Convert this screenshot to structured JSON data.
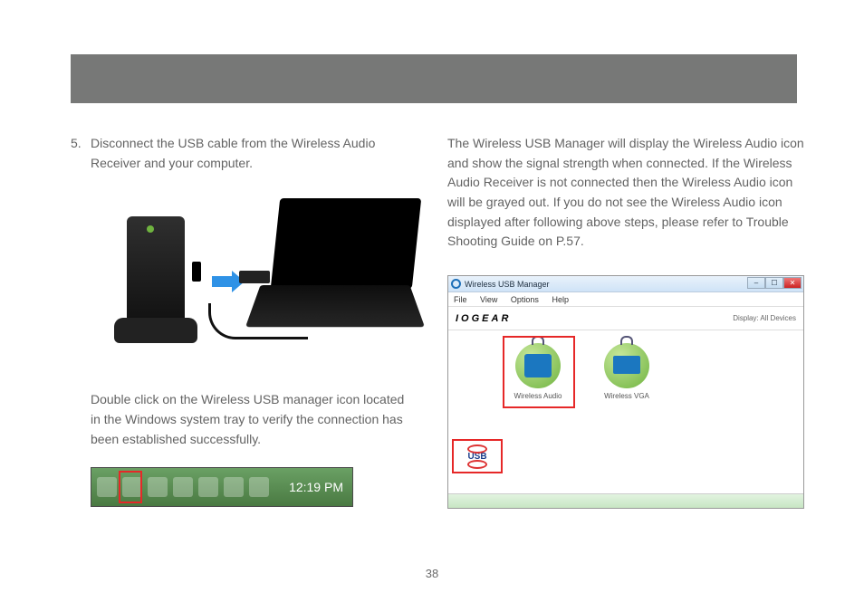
{
  "page_number": "38",
  "step": {
    "number": "5.",
    "text": "Disconnect the USB cable from the Wireless Audio Receiver and your computer."
  },
  "paragraph_left": "Double click on the Wireless USB manager icon located in the Windows system tray to verify the connection has been established successfully.",
  "paragraph_right": "The Wireless USB Manager will display the Wireless Audio icon and show the signal strength when connected.  If the Wireless Audio Receiver is not connected then the Wireless Audio icon will be grayed out.  If you do not see the Wireless Audio icon displayed after following above steps, please refer to Trouble Shooting Guide on P.57.",
  "tray": {
    "clock": "12:19 PM"
  },
  "window": {
    "title": "Wireless USB Manager",
    "menu": {
      "file": "File",
      "view": "View",
      "options": "Options",
      "help": "Help"
    },
    "brand": "IOGEAR",
    "display_label": "Display: All Devices",
    "devices": {
      "audio": "Wireless Audio",
      "vga": "Wireless VGA"
    },
    "usb_badge": "USB",
    "buttons": {
      "min": "–",
      "max": "☐",
      "close": "✕"
    }
  }
}
